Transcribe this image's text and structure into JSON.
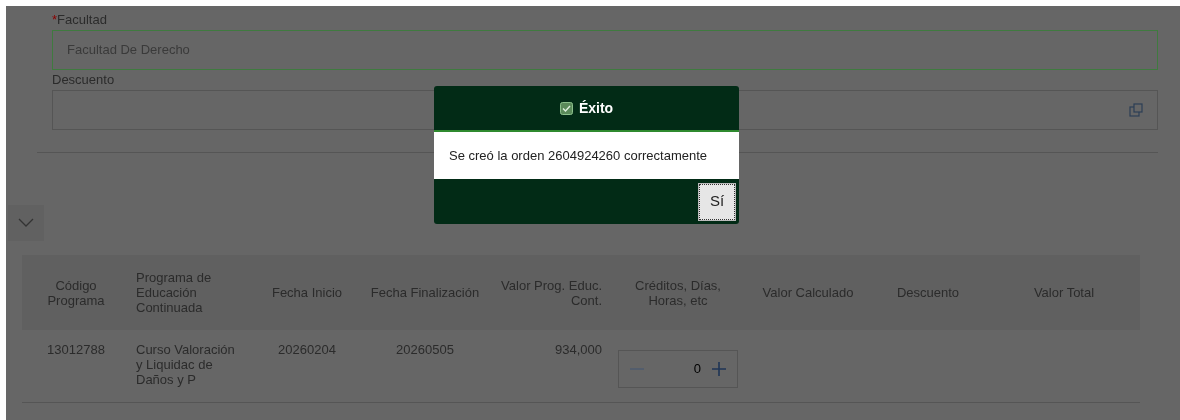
{
  "form": {
    "fields": [
      {
        "label": "Facultad",
        "required_mark": "*",
        "value": "Facultad De Derecho",
        "kind": "text",
        "focused": true
      },
      {
        "label": "Descuento",
        "kind": "lookup",
        "focused": false
      }
    ]
  },
  "dialog": {
    "title": "Éxito",
    "message": "Se creó la orden 2604924260 correctamente",
    "buttons": [
      "Sí"
    ]
  },
  "table": {
    "columns": [
      "Código Programa",
      "Programa de Educación Continuada",
      "Fecha Inicio",
      "Fecha Finalización",
      "Valor Prog. Educ. Cont.",
      "Créditos, Días, Horas, etc",
      "Valor Calculado",
      "Descuento",
      "Valor Total"
    ],
    "rows": [
      {
        "cells": [
          "13012788",
          "Curso Valoración y Liquidac de Daños y P",
          "20260204",
          "20260505",
          "934,000"
        ],
        "stepper": {
          "value": "0"
        }
      }
    ]
  }
}
